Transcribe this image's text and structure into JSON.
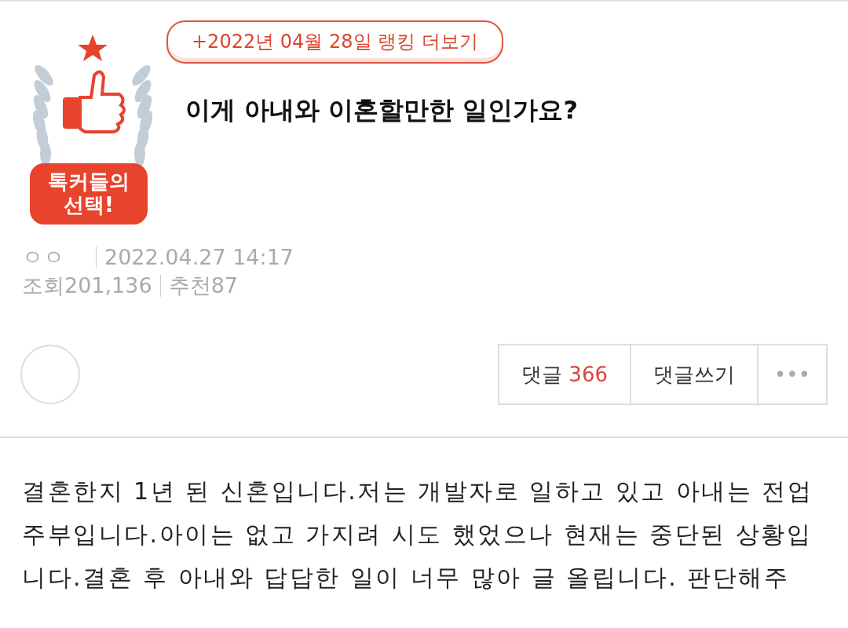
{
  "ranking_link": "+2022년 04월 28일 랭킹 더보기",
  "badge": {
    "label_line1": "톡커들의",
    "label_line2": "선택!"
  },
  "post": {
    "title": "이게 아내와 이혼할만한 일인가요?",
    "author": "ㅇㅇ",
    "date": "2022.04.27 14:17",
    "views_label": "조회",
    "views": "201,136",
    "likes_label": "추천",
    "likes": "87"
  },
  "actions": {
    "comments_label": "댓글",
    "comments_count": "366",
    "write_comment": "댓글쓰기",
    "more": "•••"
  },
  "body": "결혼한지 1년 된 신혼입니다.저는 개발자로 일하고 있고 아내는 전업주부입니다.아이는 없고 가지려 시도 했었으나 현재는 중단된 상황입니다.결혼 후 아내와 답답한 일이 너무 많아 글 올립니다. 판단해주"
}
